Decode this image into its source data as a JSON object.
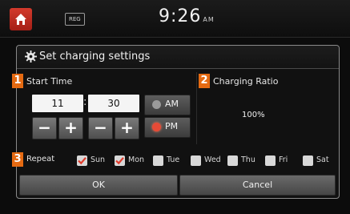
{
  "status_bar": {
    "badge": "REG",
    "time": "9:26",
    "ampm": "AM"
  },
  "dialog": {
    "title": "Set charging settings",
    "start_time": {
      "badge": "1",
      "label": "Start Time",
      "hour": "11",
      "minute": "30",
      "am_label": "AM",
      "pm_label": "PM",
      "selected": "PM"
    },
    "charging_ratio": {
      "badge": "2",
      "label": "Charging Ratio",
      "value": "100%"
    },
    "repeat": {
      "badge": "3",
      "label": "Repeat",
      "days": [
        {
          "label": "Sun",
          "checked": true
        },
        {
          "label": "Mon",
          "checked": true
        },
        {
          "label": "Tue",
          "checked": false
        },
        {
          "label": "Wed",
          "checked": false
        },
        {
          "label": "Thu",
          "checked": false
        },
        {
          "label": "Fri",
          "checked": false
        },
        {
          "label": "Sat",
          "checked": false
        }
      ]
    },
    "ok_label": "OK",
    "cancel_label": "Cancel"
  },
  "colors": {
    "accent_orange": "#e56a12",
    "radio_on": "#e64a36",
    "checkmark": "#e23b2b"
  }
}
